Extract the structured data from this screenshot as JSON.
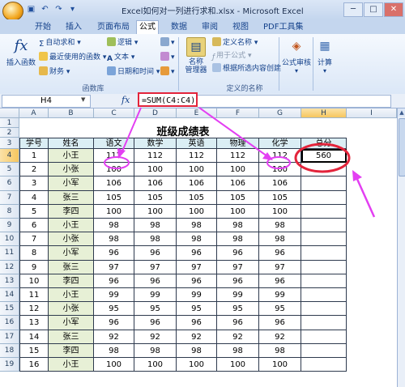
{
  "window": {
    "title": "Excel如何对一列进行求和.xlsx - Microsoft Excel",
    "quick_access": [
      "save-icon",
      "undo-icon",
      "redo-icon"
    ]
  },
  "tabs": [
    "开始",
    "插入",
    "页面布局",
    "公式",
    "数据",
    "审阅",
    "视图",
    "PDF工具集"
  ],
  "active_tab": "公式",
  "ribbon": {
    "insert_function": "插入函数",
    "autosum": "自动求和",
    "recently_used": "最近使用的函数",
    "financial": "财务",
    "logical": "逻辑",
    "text": "文本",
    "date_time": "日期和时间",
    "group_function_library": "函数库",
    "name_manager": "名称\n管理器",
    "define_name": "定义名称",
    "use_in_formula": "用于公式",
    "create_from_selection": "根据所选内容创建",
    "group_defined_names": "定义的名称",
    "formula_auditing": "公式审核",
    "calculation": "计算"
  },
  "formula_bar": {
    "name_box": "H4",
    "fx": "fx",
    "formula": "=SUM(C4:C4)"
  },
  "sheet": {
    "columns": [
      "A",
      "B",
      "C",
      "D",
      "E",
      "F",
      "G",
      "H",
      "I"
    ],
    "selected_column": "H",
    "selected_row": "4",
    "title": "班级成绩表",
    "headers": [
      "学号",
      "姓名",
      "语文",
      "数学",
      "英语",
      "物理",
      "化学",
      "总分"
    ],
    "rows": [
      {
        "no": "1",
        "name": "小王",
        "scores": [
          "112",
          "112",
          "112",
          "112",
          "112"
        ],
        "total": "560"
      },
      {
        "no": "2",
        "name": "小张",
        "scores": [
          "100",
          "100",
          "100",
          "100",
          "100"
        ],
        "total": ""
      },
      {
        "no": "3",
        "name": "小军",
        "scores": [
          "106",
          "106",
          "106",
          "106",
          "106"
        ],
        "total": ""
      },
      {
        "no": "4",
        "name": "张三",
        "scores": [
          "105",
          "105",
          "105",
          "105",
          "105"
        ],
        "total": ""
      },
      {
        "no": "5",
        "name": "李四",
        "scores": [
          "100",
          "100",
          "100",
          "100",
          "100"
        ],
        "total": ""
      },
      {
        "no": "6",
        "name": "小王",
        "scores": [
          "98",
          "98",
          "98",
          "98",
          "98"
        ],
        "total": ""
      },
      {
        "no": "7",
        "name": "小张",
        "scores": [
          "98",
          "98",
          "98",
          "98",
          "98"
        ],
        "total": ""
      },
      {
        "no": "8",
        "name": "小军",
        "scores": [
          "96",
          "96",
          "96",
          "96",
          "96"
        ],
        "total": ""
      },
      {
        "no": "9",
        "name": "张三",
        "scores": [
          "97",
          "97",
          "97",
          "97",
          "97"
        ],
        "total": ""
      },
      {
        "no": "10",
        "name": "李四",
        "scores": [
          "96",
          "96",
          "96",
          "96",
          "96"
        ],
        "total": ""
      },
      {
        "no": "11",
        "name": "小王",
        "scores": [
          "99",
          "99",
          "99",
          "99",
          "99"
        ],
        "total": ""
      },
      {
        "no": "12",
        "name": "小张",
        "scores": [
          "95",
          "95",
          "95",
          "95",
          "95"
        ],
        "total": ""
      },
      {
        "no": "13",
        "name": "小军",
        "scores": [
          "96",
          "96",
          "96",
          "96",
          "96"
        ],
        "total": ""
      },
      {
        "no": "14",
        "name": "张三",
        "scores": [
          "92",
          "92",
          "92",
          "92",
          "92"
        ],
        "total": ""
      },
      {
        "no": "15",
        "name": "李四",
        "scores": [
          "98",
          "98",
          "98",
          "98",
          "98"
        ],
        "total": ""
      },
      {
        "no": "16",
        "name": "小王",
        "scores": [
          "100",
          "100",
          "100",
          "100",
          "100"
        ],
        "total": ""
      }
    ]
  },
  "colors": {
    "header_fill": "#dbeef4",
    "name_fill": "#e7f0d6",
    "annotation": "#e3243b",
    "arrow": "#e33ff2"
  }
}
